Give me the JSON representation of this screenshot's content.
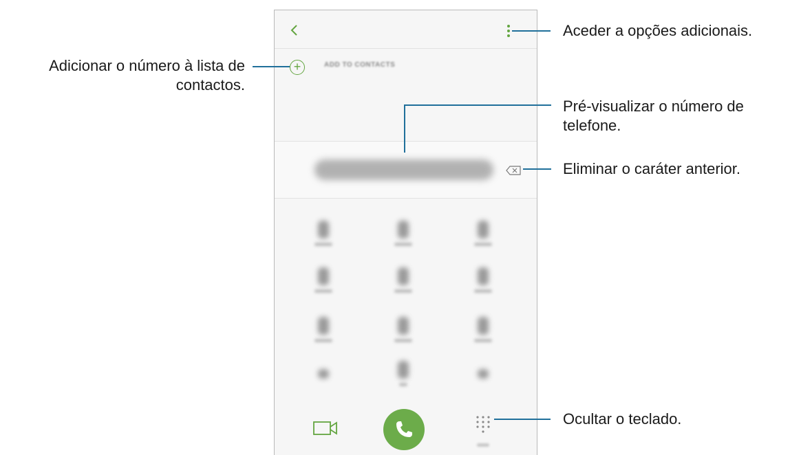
{
  "callouts": {
    "add_contact_line1": "Adicionar o número à lista de",
    "add_contact_line2": "contactos.",
    "more_options": "Aceder a opções adicionais.",
    "preview_line1": "Pré-visualizar o número de",
    "preview_line2": "telefone.",
    "delete_char": "Eliminar o caráter anterior.",
    "hide_keypad": "Ocultar o teclado."
  },
  "dialer": {
    "add_to_contacts_label": "ADD TO CONTACTS",
    "add_icon_glyph": "+",
    "icons": {
      "back": "chevron-left-icon",
      "more": "more-vertical-icon",
      "add": "plus-circle-icon",
      "backspace": "backspace-icon",
      "video_call": "video-camera-icon",
      "call": "phone-icon",
      "keypad": "dialpad-icon"
    }
  },
  "colors": {
    "accent_green": "#63a540",
    "call_button": "#6cac4a",
    "callout_line": "#1f6f9a"
  }
}
